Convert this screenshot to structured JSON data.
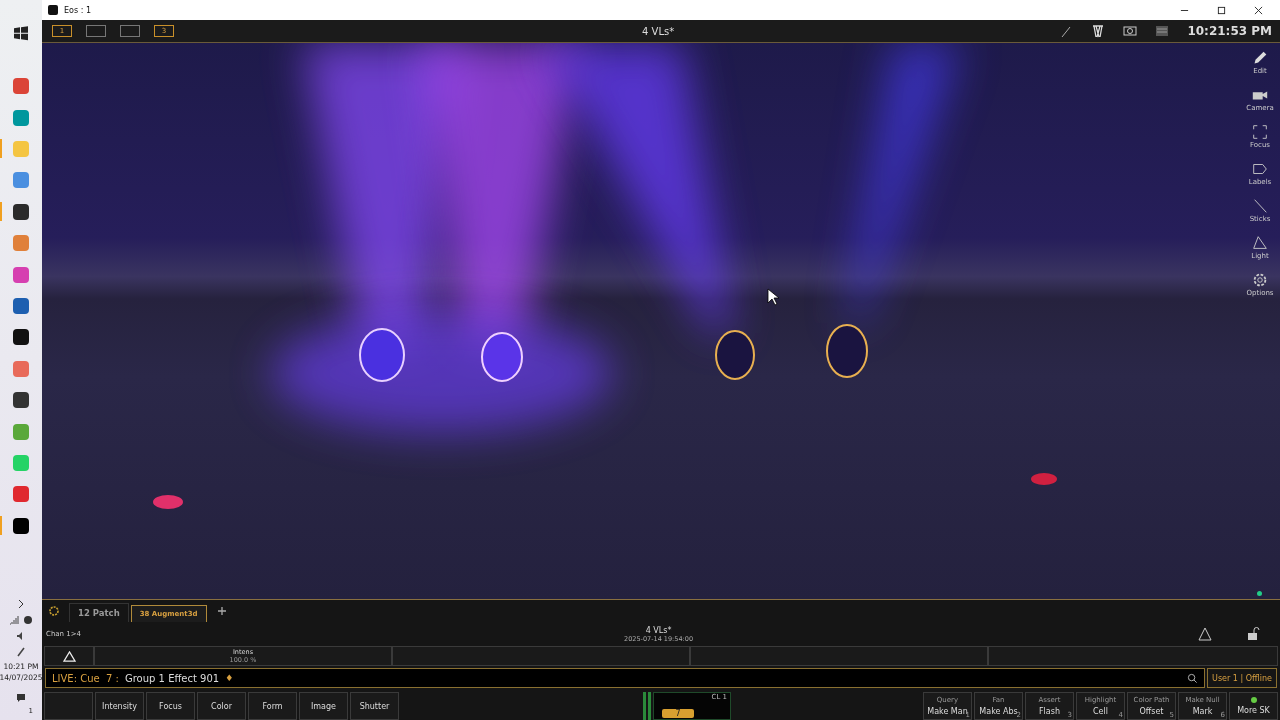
{
  "taskbar": {
    "apps": [
      {
        "color": "#db4437",
        "running": false
      },
      {
        "color": "#00979d",
        "running": false
      },
      {
        "color": "#f4c542",
        "running": true
      },
      {
        "color": "#4a8fe0",
        "running": false
      },
      {
        "color": "#2b2b2b",
        "running": true
      },
      {
        "color": "#e0803a",
        "running": false
      },
      {
        "color": "#d63fb0",
        "running": false
      },
      {
        "color": "#1d5fb0",
        "running": false
      },
      {
        "color": "#111111",
        "running": false
      },
      {
        "color": "#e86a5a",
        "running": false
      },
      {
        "color": "#333333",
        "running": false
      },
      {
        "color": "#5aa83a",
        "running": false
      },
      {
        "color": "#25d366",
        "running": false
      },
      {
        "color": "#e0292f",
        "running": false
      },
      {
        "color": "#000000",
        "running": true
      }
    ],
    "time": "10:21 PM",
    "date": "14/07/2025",
    "notifications": "1"
  },
  "window": {
    "title": "Eos : 1"
  },
  "toolbar": {
    "workspaces": [
      {
        "label": "1",
        "active": true
      },
      {
        "active": false
      },
      {
        "active": false
      },
      {
        "label": "3",
        "active": true
      }
    ],
    "title": "4 VLs*",
    "clock": "10:21:53 PM"
  },
  "tools": [
    "Edit",
    "Camera",
    "Focus",
    "Labels",
    "Sticks",
    "Light",
    "Options"
  ],
  "tabs": [
    {
      "label": "12 Patch",
      "selected": false
    },
    {
      "label": "38 Augment3d",
      "selected": true
    }
  ],
  "command": {
    "selection": "Chan 1>4",
    "show": "4 VLs*",
    "timestamp": "2025-07-14 19:54:00",
    "param_name": "Intens",
    "param_value": "100.0 %",
    "live_prefix": "LIVE: Cue  7 :",
    "live_text": "Group 1 Effect 901",
    "live_mark": "♦",
    "user": "User 1 | Offline"
  },
  "categories": [
    "Intensity",
    "Focus",
    "Color",
    "Form",
    "Image",
    "Shutter"
  ],
  "fader": {
    "label": "CL 1",
    "cue": "7"
  },
  "softkeys": [
    {
      "top": "Query",
      "main": "Make Man",
      "num": "1"
    },
    {
      "top": "Fan",
      "main": "Make Abs",
      "num": "2"
    },
    {
      "top": "Assert",
      "main": "Flash",
      "num": "3"
    },
    {
      "top": "Highlight",
      "main": "Cell",
      "num": "4"
    },
    {
      "top": "Color Path",
      "main": "Offset",
      "num": "5"
    },
    {
      "top": "Make Null",
      "main": "Mark",
      "num": "6"
    }
  ],
  "more": "More SK"
}
